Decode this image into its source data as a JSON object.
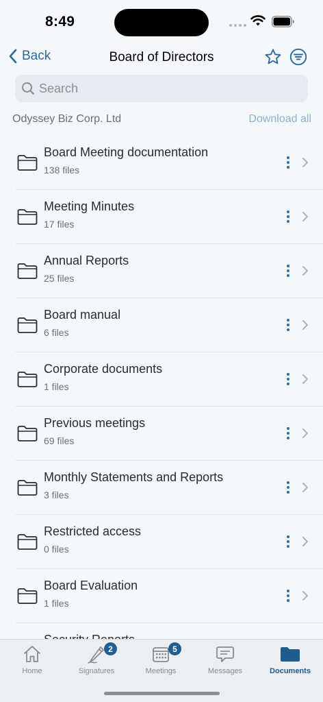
{
  "status": {
    "time": "8:49"
  },
  "nav": {
    "back_label": "Back",
    "title": "Board of Directors"
  },
  "search": {
    "placeholder": "Search",
    "value": ""
  },
  "section": {
    "org_name": "Odyssey Biz Corp. Ltd",
    "download_all": "Download all"
  },
  "folders": [
    {
      "name": "Board Meeting documentation",
      "count": "138 files"
    },
    {
      "name": "Meeting Minutes",
      "count": "17 files"
    },
    {
      "name": "Annual Reports",
      "count": "25 files"
    },
    {
      "name": "Board manual",
      "count": "6 files"
    },
    {
      "name": "Corporate documents",
      "count": "1 files"
    },
    {
      "name": "Previous meetings",
      "count": "69 files"
    },
    {
      "name": "Monthly Statements and Reports",
      "count": "3 files"
    },
    {
      "name": "Restricted access",
      "count": "0 files"
    },
    {
      "name": "Board Evaluation",
      "count": "1 files"
    },
    {
      "name": "Security Reports",
      "count": ""
    }
  ],
  "tabs": [
    {
      "label": "Home",
      "icon": "home-icon"
    },
    {
      "label": "Signatures",
      "icon": "pen-icon",
      "badge": "2"
    },
    {
      "label": "Meetings",
      "icon": "calendar-icon",
      "badge": "5"
    },
    {
      "label": "Messages",
      "icon": "chat-icon"
    },
    {
      "label": "Documents",
      "icon": "folder-icon",
      "active": true
    }
  ],
  "colors": {
    "accent": "#2a6a9e",
    "active_tab": "#1f5b8c",
    "background": "#f5f8fb",
    "muted_link": "#8db1cc"
  }
}
